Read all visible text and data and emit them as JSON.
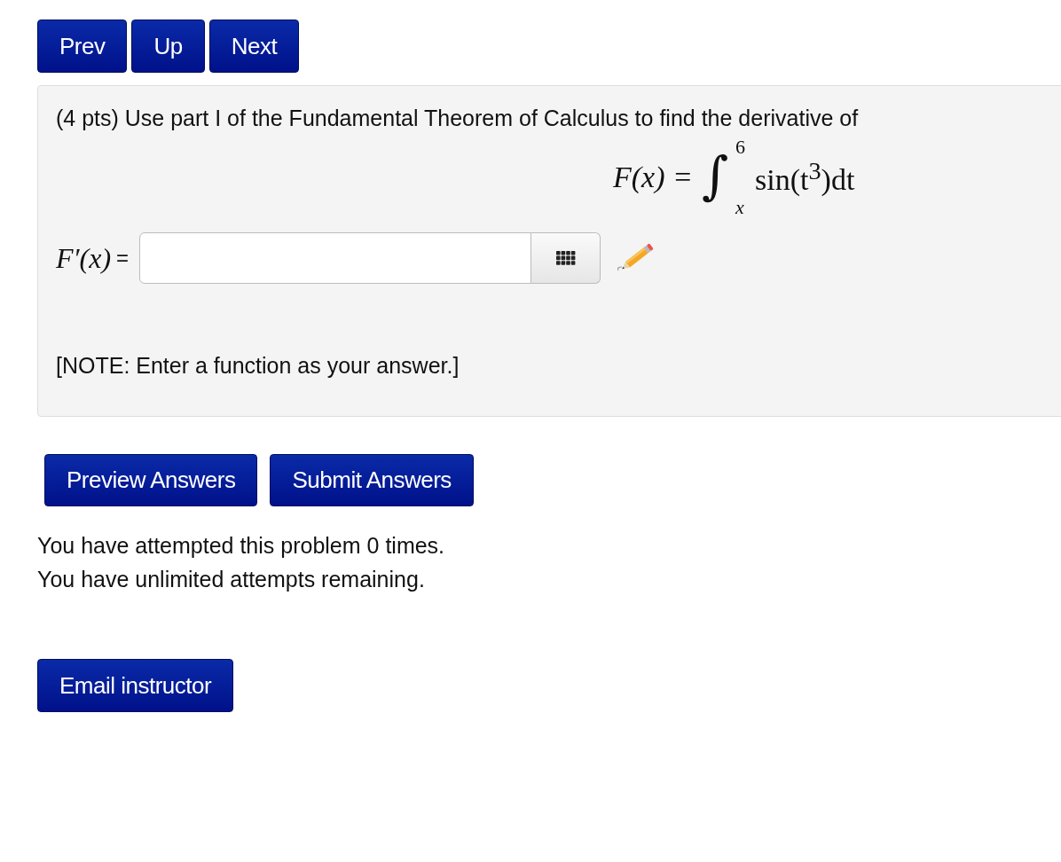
{
  "nav_buttons": [
    "Prev",
    "Up",
    "Next"
  ],
  "problem": {
    "statement": "(4 pts) Use part I of the Fundamental Theorem of Calculus to find the derivative of",
    "formula": {
      "lhs": "F(x) =",
      "integral_sign": "∫",
      "upper": "6",
      "lower": "x",
      "integrand": "sin(t$^{3}$)dt"
    },
    "answer": {
      "label": "F′(x)",
      "equals": "="
    },
    "note": "[NOTE: Enter a function as your answer.]"
  },
  "action_buttons": [
    "Preview Answers",
    "Submit Answers"
  ],
  "attempts": [
    "You have attempted this problem 0 times.",
    "You have unlimited attempts remaining."
  ],
  "email_button": "Email instructor"
}
